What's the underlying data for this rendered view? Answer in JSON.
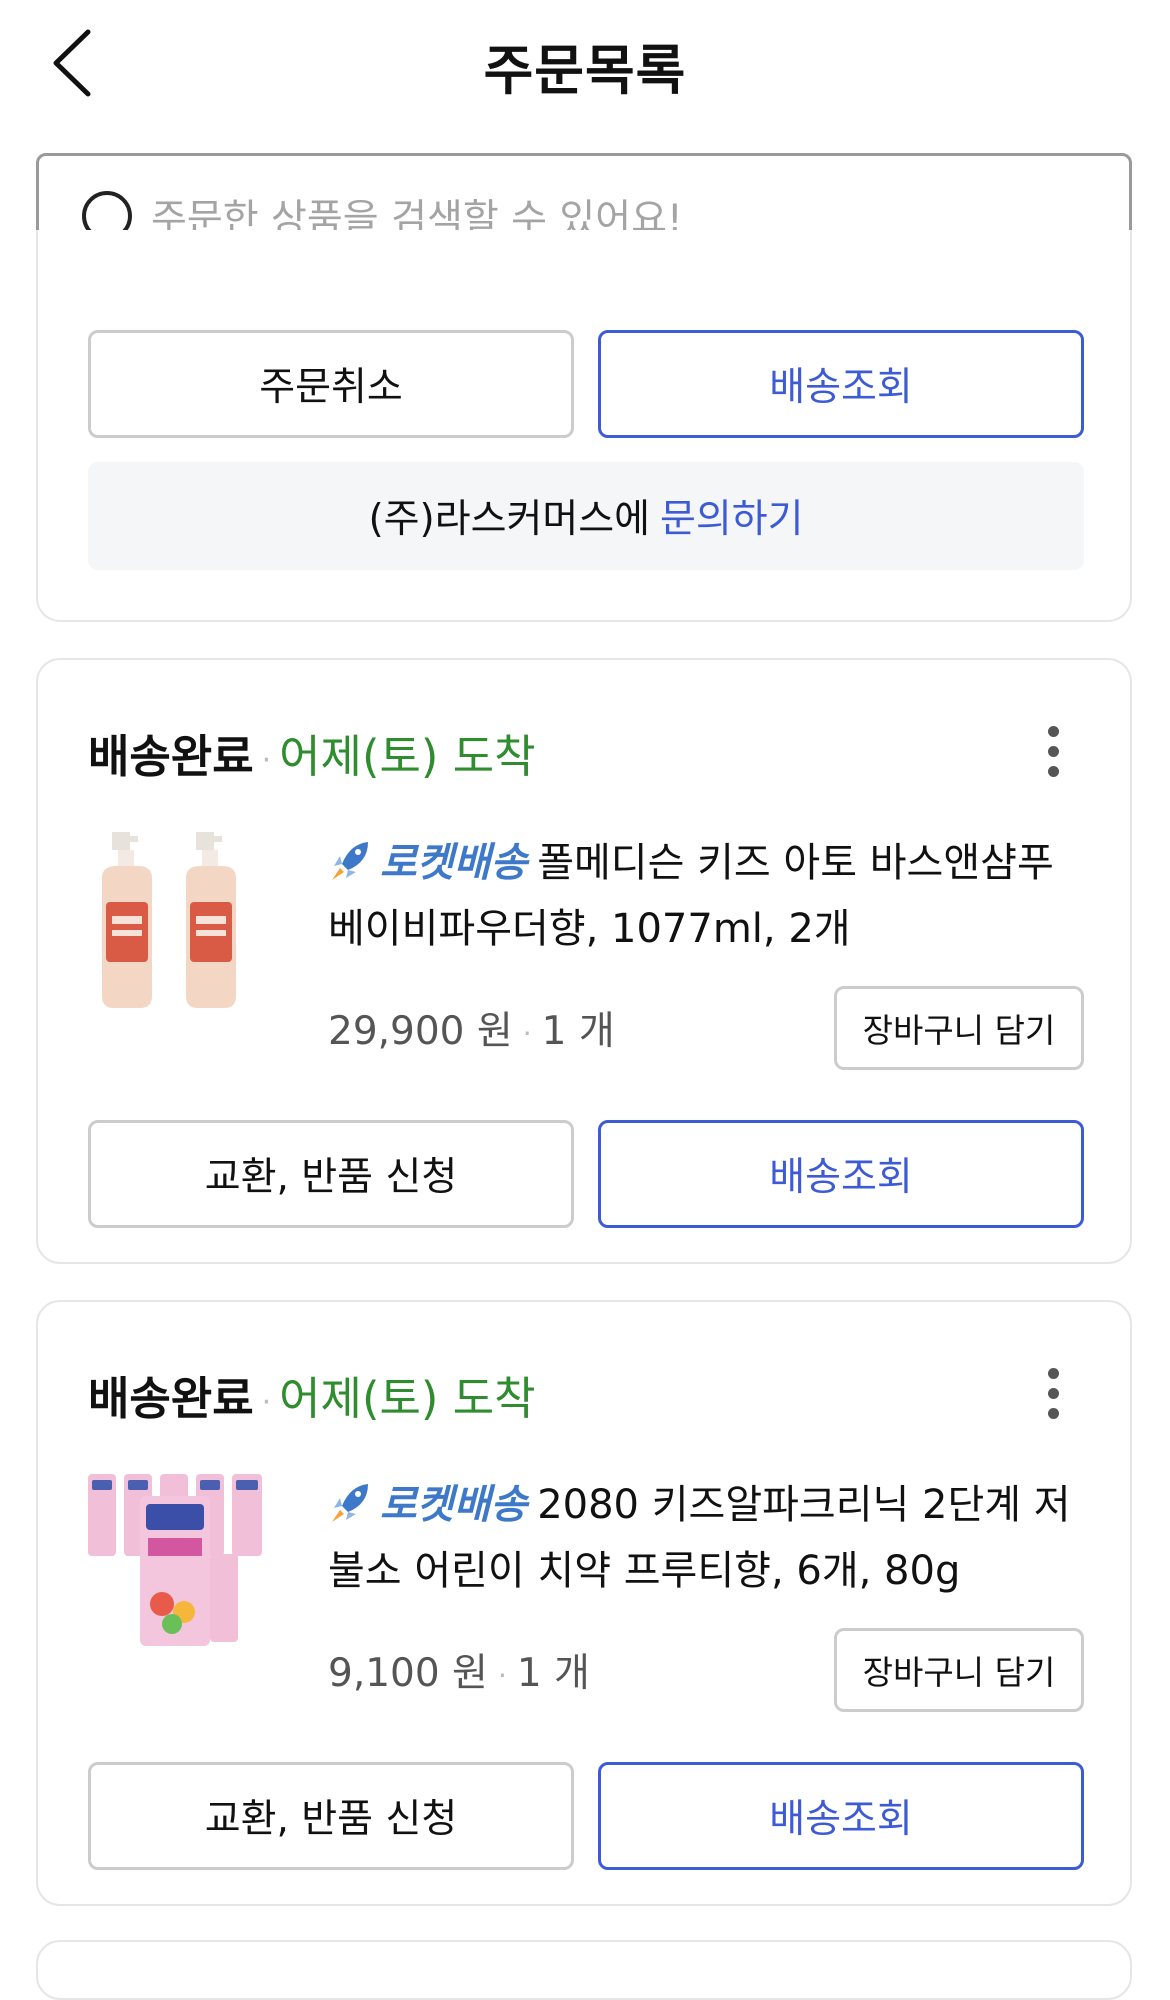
{
  "header": {
    "title": "주문목록",
    "back_icon": "chevron-left-icon"
  },
  "search": {
    "placeholder": "주문한 상품을 검색할 수 있어요!",
    "value": "",
    "icon": "search-icon"
  },
  "top_card": {
    "cancel_label": "주문취소",
    "track_label": "배송조회",
    "seller_text": "(주)라스커머스에",
    "inquiry_label": "문의하기"
  },
  "orders": [
    {
      "status": "배송완료",
      "arrival": "어제(토) 도착",
      "delivery_badge": "로켓배송",
      "product_name": "폴메디슨 키즈 아토 바스앤샴푸 베이비파우더향, 1077ml, 2개",
      "price": "29,900 원",
      "quantity": "1 개",
      "cart_label": "장바구니 담기",
      "exchange_label": "교환, 반품 신청",
      "track_label": "배송조회"
    },
    {
      "status": "배송완료",
      "arrival": "어제(토) 도착",
      "delivery_badge": "로켓배송",
      "product_name": "2080 키즈알파크리닉 2단계 저불소 어린이 치약 프루티향, 6개, 80g",
      "price": "9,100 원",
      "quantity": "1 개",
      "cart_label": "장바구니 담기",
      "exchange_label": "교환, 반품 신청",
      "track_label": "배송조회"
    }
  ],
  "colors": {
    "accent_blue": "#3e5bd6",
    "arrival_green": "#2f8d2f",
    "rocket_blue": "#3e79c9"
  }
}
